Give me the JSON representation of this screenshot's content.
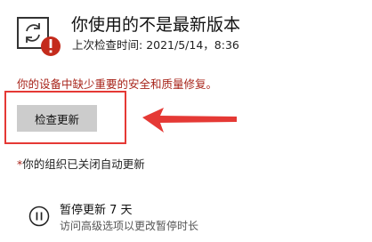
{
  "status": {
    "icon": "sync-warning-icon",
    "title": "你使用的不是最新版本",
    "last_checked_label": "上次检查时间:",
    "last_checked_value": "2021/5/14，8:36"
  },
  "warning_message": "你的设备中缺少重要的安全和质量修复。",
  "check_button_label": "检查更新",
  "annotation": {
    "highlight_color": "#e53935",
    "arrow_icon": "arrow-left-icon"
  },
  "org_note": {
    "asterisk": "*",
    "text": "你的组织已关闭自动更新"
  },
  "pause": {
    "icon": "pause-icon",
    "title": "暂停更新 7 天",
    "subtitle": "访问高级选项以更改暂停时长"
  },
  "colors": {
    "warning_text": "#a8251b",
    "error_badge": "#c42b1c",
    "button_bg": "#cccccc"
  }
}
